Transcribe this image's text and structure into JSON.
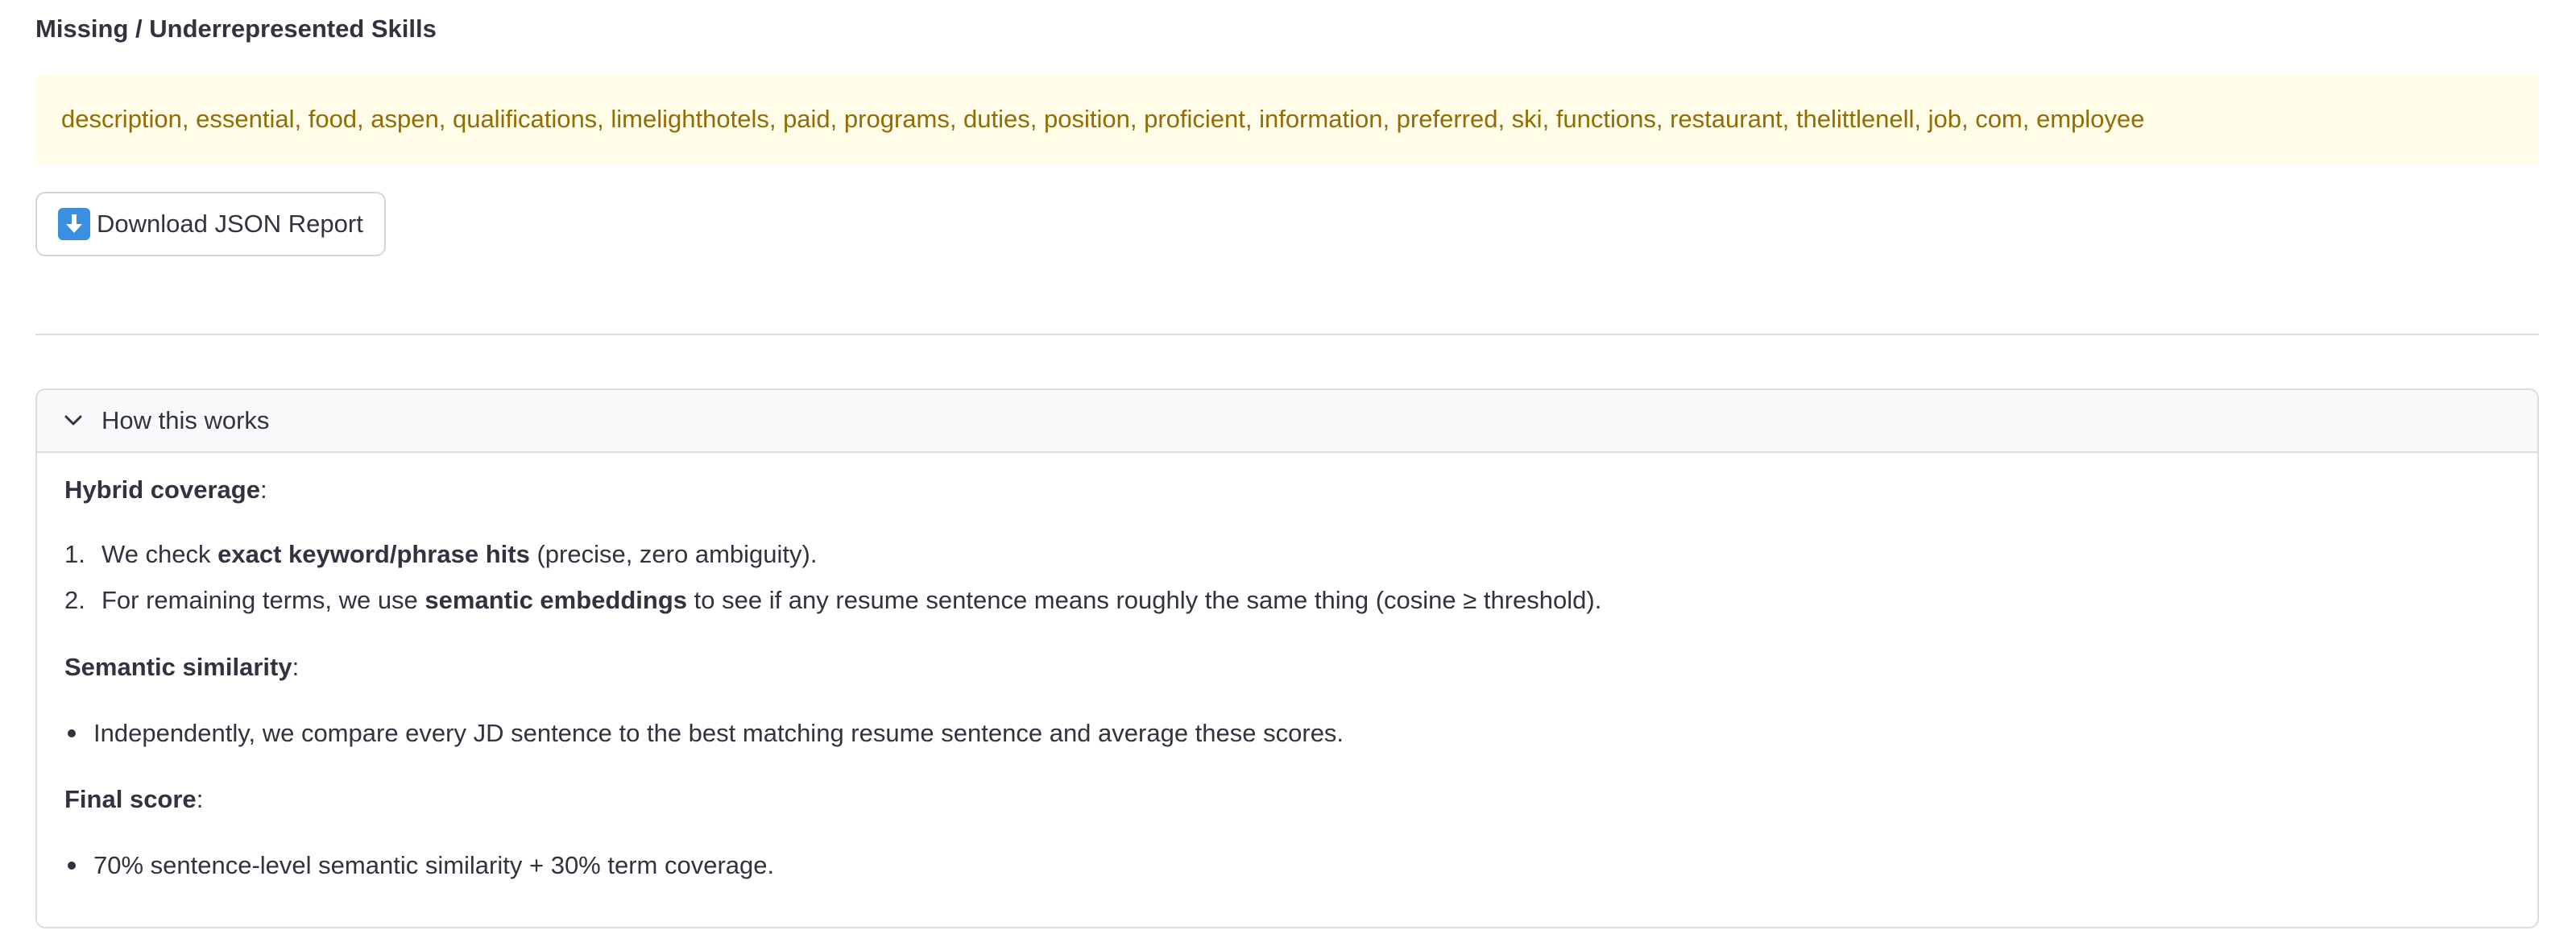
{
  "missing_section": {
    "title": "Missing / Underrepresented Skills",
    "skills_text": "description, essential, food, aspen, qualifications, limelighthotels, paid, programs, duties, position, proficient, information, preferred, ski, functions, restaurant, thelittlenell, job, com, employee"
  },
  "download_button": {
    "label": "Download JSON Report",
    "icon": "down-arrow-emoji-icon"
  },
  "expander": {
    "title": "How this works",
    "hybrid": {
      "heading": "Hybrid coverage",
      "heading_suffix": ":",
      "items": [
        {
          "marker": "1.",
          "pre": "We check ",
          "bold": "exact keyword/phrase hits",
          "post": " (precise, zero ambiguity)."
        },
        {
          "marker": "2.",
          "pre": "For remaining terms, we use ",
          "bold": "semantic embeddings",
          "post": " to see if any resume sentence means roughly the same thing (cosine ≥ threshold)."
        }
      ]
    },
    "semantic": {
      "heading": "Semantic similarity",
      "heading_suffix": ":",
      "item": "Independently, we compare every JD sentence to the best matching resume sentence and average these scores."
    },
    "final": {
      "heading": "Final score",
      "heading_suffix": ":",
      "item": "70% sentence-level semantic similarity + 30% term coverage."
    }
  },
  "colors": {
    "warning_bg": "#fffce7",
    "warning_text": "#926c05",
    "text": "#31333f",
    "border": "#dcdce0"
  }
}
